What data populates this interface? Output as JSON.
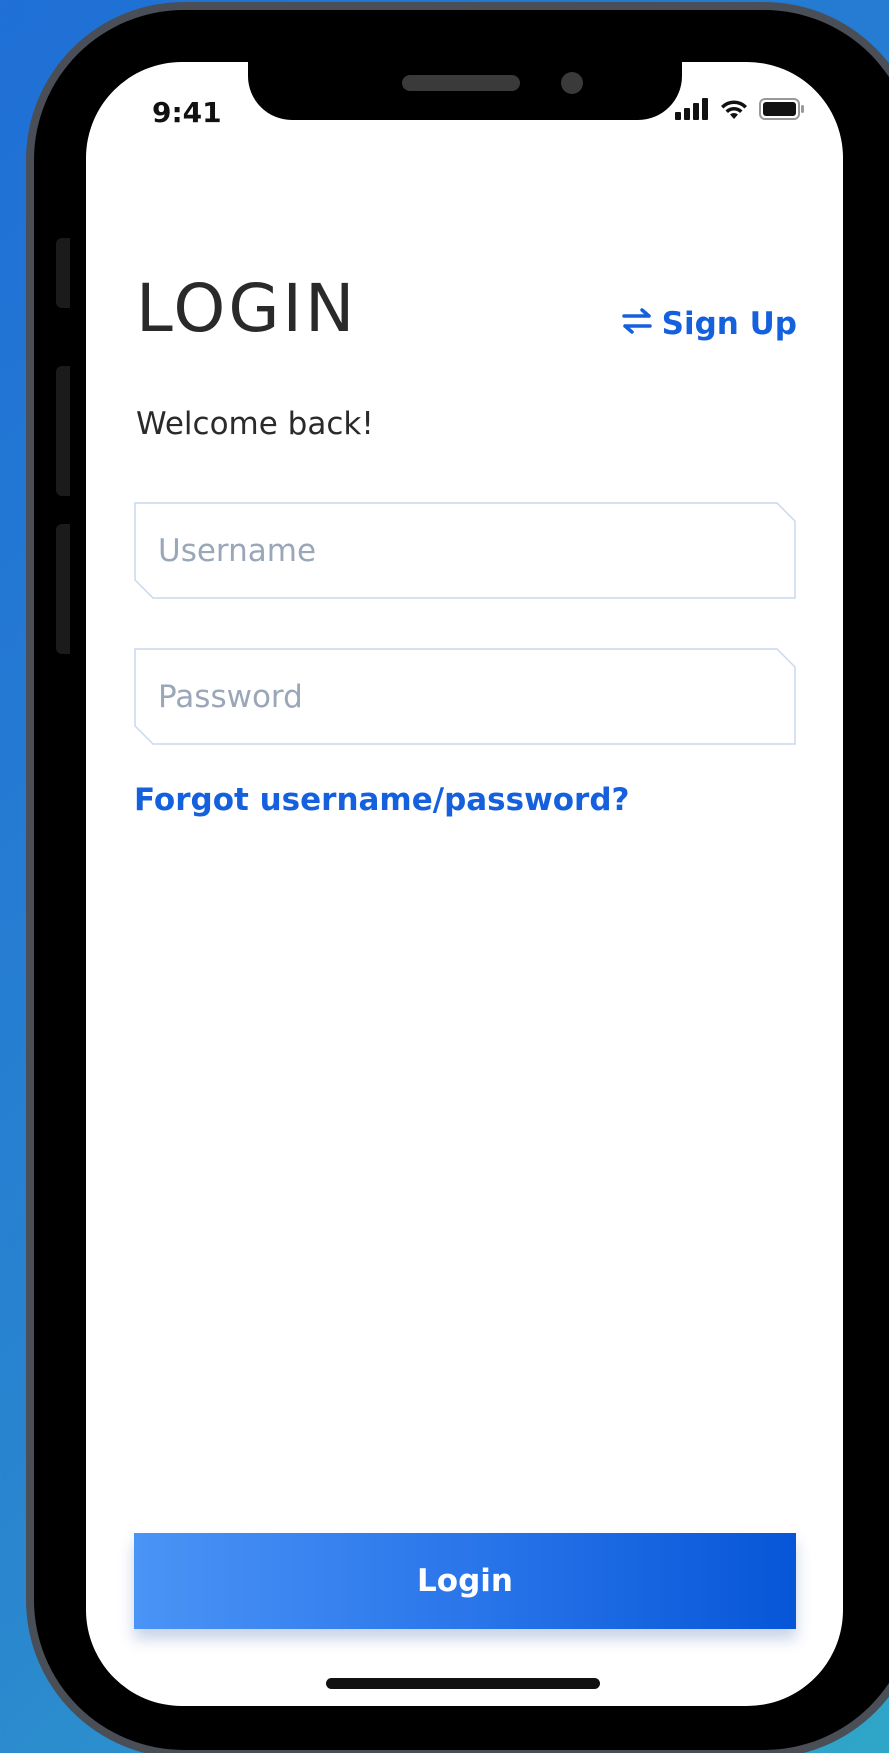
{
  "status": {
    "time": "9:41",
    "icons": [
      "signal-icon",
      "wifi-icon",
      "battery-icon"
    ]
  },
  "header": {
    "title": "LOGIN",
    "signup_label": "Sign Up",
    "signup_icon": "swap-arrows-icon"
  },
  "welcome_text": "Welcome back!",
  "form": {
    "username_placeholder": "Username",
    "username_value": "",
    "password_placeholder": "Password",
    "password_value": "",
    "forgot_label": "Forgot username/password?",
    "login_label": "Login"
  },
  "colors": {
    "accent": "#1560dc",
    "button_start": "#4a94f6",
    "button_end": "#0756d8",
    "field_border": "#c9d8ee"
  }
}
